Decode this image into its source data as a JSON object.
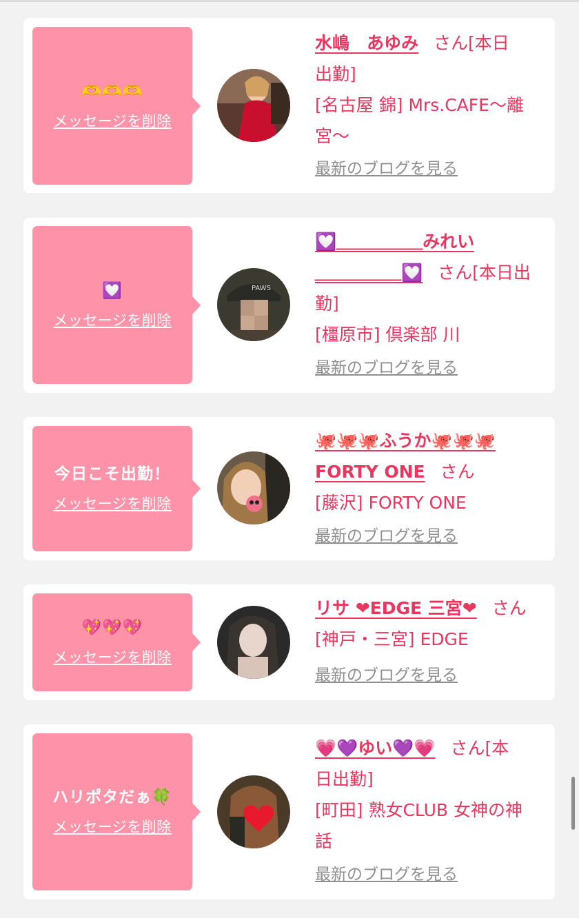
{
  "delete_label": "メッセージを削除",
  "blog_label": "最新のブログを見る",
  "san_suffix": "さん",
  "cards": [
    {
      "message": "🫶🫶🫶",
      "name": "水嶋　あゆみ",
      "name_tail": "[本日",
      "line2": "出勤]",
      "shop_line1": "[名古屋 錦] Mrs.CAFE～離",
      "shop_line2": "宮～",
      "avatar_desc": "photo-woman-red-dress"
    },
    {
      "message": "💟",
      "name_line1": "💟＿＿＿＿＿みれい",
      "name_line2": "＿＿＿＿＿💟",
      "name_tail": "[本日出",
      "line3": "勤]",
      "shop_line1": "[橿原市] 倶楽部 川",
      "avatar_desc": "photo-blurred-face-cap"
    },
    {
      "message": "今日こそ出勤！",
      "name_line1": "🐙🐙🐙ふうか🐙🐙🐙",
      "name_line2": "FORTY ONE",
      "shop_line1": "[藤沢] FORTY ONE",
      "avatar_desc": "photo-woman-octopus-sticker"
    },
    {
      "message": "💖💖💖",
      "name": "リサ ❤EDGE 三宮❤",
      "shop_line1": "[神戸・三宮] EDGE",
      "avatar_desc": "photo-woman-dark"
    },
    {
      "message": "ハリポタだぁ🍀",
      "name": "💗💜ゆい💜💗",
      "name_tail": "[本",
      "line2": "日出勤]",
      "shop_line1": "[町田] 熟女CLUB 女神の神",
      "shop_line2": "話",
      "avatar_desc": "photo-heart-sticker"
    }
  ],
  "colors": {
    "accent": "#e8365f",
    "bubble": "#fd92a8",
    "background": "#f2f2f2"
  }
}
